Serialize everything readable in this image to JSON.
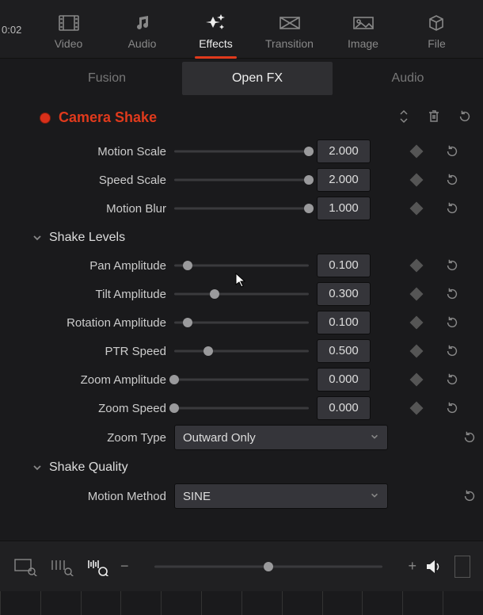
{
  "timecode": "0:02",
  "topTabs": {
    "items": [
      "Video",
      "Audio",
      "Effects",
      "Transition",
      "Image",
      "File"
    ],
    "activeIndex": 2
  },
  "subTabs": {
    "items": [
      "Fusion",
      "Open FX",
      "Audio"
    ],
    "activeIndex": 1
  },
  "effect": {
    "name": "Camera Shake"
  },
  "motion": [
    {
      "label": "Motion Scale",
      "value": "2.000",
      "pos": 100
    },
    {
      "label": "Speed Scale",
      "value": "2.000",
      "pos": 100
    },
    {
      "label": "Motion Blur",
      "value": "1.000",
      "pos": 100
    }
  ],
  "sections": {
    "shakeLevels": "Shake Levels",
    "shakeQuality": "Shake Quality"
  },
  "shakeLevels": [
    {
      "label": "Pan Amplitude",
      "value": "0.100",
      "pos": 10
    },
    {
      "label": "Tilt Amplitude",
      "value": "0.300",
      "pos": 30
    },
    {
      "label": "Rotation Amplitude",
      "value": "0.100",
      "pos": 10
    },
    {
      "label": "PTR Speed",
      "value": "0.500",
      "pos": 25
    },
    {
      "label": "Zoom Amplitude",
      "value": "0.000",
      "pos": 0
    },
    {
      "label": "Zoom Speed",
      "value": "0.000",
      "pos": 0
    }
  ],
  "zoomType": {
    "label": "Zoom Type",
    "value": "Outward Only"
  },
  "motionMethod": {
    "label": "Motion Method",
    "value": "SINE"
  },
  "bottom": {
    "zoomPos": 50
  }
}
